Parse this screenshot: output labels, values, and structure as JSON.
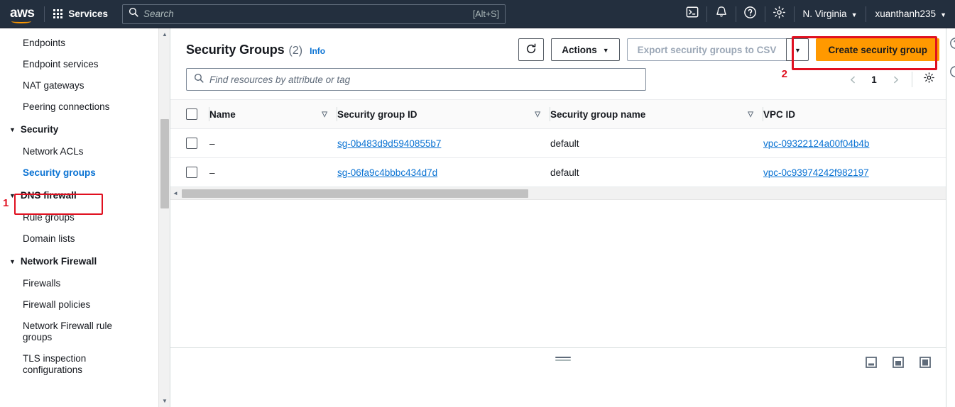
{
  "topnav": {
    "logo_alt": "aws",
    "services_label": "Services",
    "search_placeholder": "Search",
    "search_shortcut": "[Alt+S]",
    "cloudshell_icon": "cloudshell-terminal-icon",
    "notifications_icon": "bell-icon",
    "help_icon": "question-circle-icon",
    "settings_icon": "gear-icon",
    "region_label": "N. Virginia",
    "account_label": "xuanthanh235"
  },
  "sidebar": {
    "items": [
      {
        "label": "Endpoints",
        "type": "link"
      },
      {
        "label": "Endpoint services",
        "type": "link"
      },
      {
        "label": "NAT gateways",
        "type": "link"
      },
      {
        "label": "Peering connections",
        "type": "link"
      },
      {
        "label": "Security",
        "type": "group"
      },
      {
        "label": "Network ACLs",
        "type": "link"
      },
      {
        "label": "Security groups",
        "type": "link",
        "selected": true
      },
      {
        "label": "DNS firewall",
        "type": "group"
      },
      {
        "label": "Rule groups",
        "type": "link"
      },
      {
        "label": "Domain lists",
        "type": "link"
      },
      {
        "label": "Network Firewall",
        "type": "group"
      },
      {
        "label": "Firewalls",
        "type": "link"
      },
      {
        "label": "Firewall policies",
        "type": "link"
      },
      {
        "label": "Network Firewall rule groups",
        "type": "link"
      },
      {
        "label": "TLS inspection configurations",
        "type": "link"
      }
    ]
  },
  "header": {
    "title": "Security Groups",
    "count": "(2)",
    "info_label": "Info",
    "refresh_icon": "refresh-icon",
    "actions_label": "Actions",
    "export_label": "Export security groups to CSV",
    "export_dropdown_icon": "chevron-down-icon",
    "create_label": "Create security group"
  },
  "filter": {
    "search_icon": "search-icon",
    "placeholder": "Find resources by attribute or tag",
    "value": "",
    "prev_icon": "chevron-left-icon",
    "page": "1",
    "next_icon": "chevron-right-icon",
    "settings_icon": "gear-icon"
  },
  "table": {
    "columns": [
      {
        "label": "Name",
        "sortable": true
      },
      {
        "label": "Security group ID",
        "sortable": true
      },
      {
        "label": "Security group name",
        "sortable": true
      },
      {
        "label": "VPC ID",
        "sortable": false
      }
    ],
    "rows": [
      {
        "name": "–",
        "sg_id": "sg-0b483d9d5940855b7",
        "sg_name": "default",
        "vpc_id": "vpc-09322124a00f04b4b"
      },
      {
        "name": "–",
        "sg_id": "sg-06fa9c4bbbc434d7d",
        "sg_name": "default",
        "vpc_id": "vpc-0c93974242f982197"
      }
    ]
  },
  "annotations": [
    {
      "number": "1",
      "target": "sidebar-item-security-groups"
    },
    {
      "number": "2",
      "target": "create-security-group-button"
    }
  ],
  "split_panel": {
    "drag_handle_icon": "drag-handle-icon",
    "size_small_icon": "panel-size-small-icon",
    "size_medium_icon": "panel-size-medium-icon",
    "size_large_icon": "panel-size-large-icon"
  },
  "colors": {
    "nav_bg": "#232f3e",
    "primary_button": "#ff9900",
    "link": "#0972d3",
    "annotation": "#e01020"
  }
}
